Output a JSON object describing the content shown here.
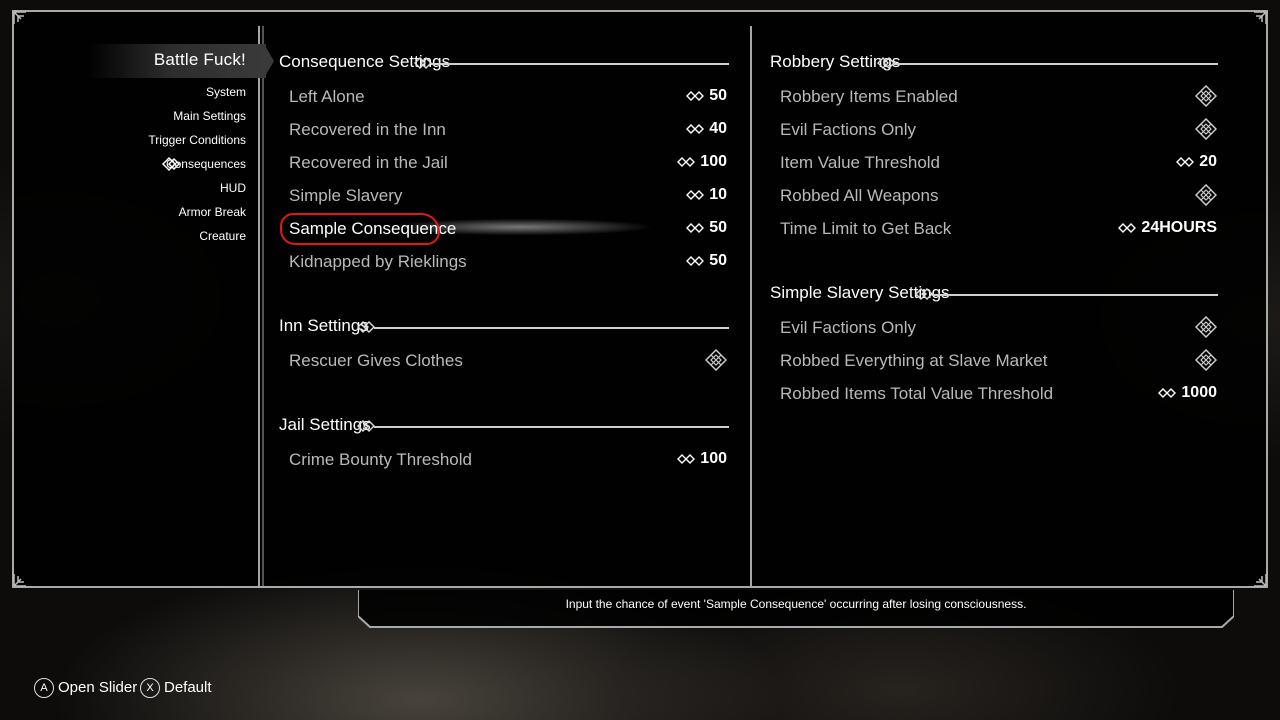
{
  "sidebar": {
    "title": "Battle Fuck!",
    "items": [
      {
        "label": "System"
      },
      {
        "label": "Main Settings"
      },
      {
        "label": "Trigger Conditions"
      },
      {
        "label": "Consequences"
      },
      {
        "label": "HUD"
      },
      {
        "label": "Armor Break"
      },
      {
        "label": "Creature"
      }
    ],
    "selected_index": 3
  },
  "left_column": {
    "consequence": {
      "title": "Consequence Settings",
      "rows": [
        {
          "label": "Left Alone",
          "value": "50"
        },
        {
          "label": "Recovered in the Inn",
          "value": "40"
        },
        {
          "label": "Recovered in the Jail",
          "value": "100"
        },
        {
          "label": "Simple Slavery",
          "value": "10"
        },
        {
          "label": "Sample Consequence",
          "value": "50"
        },
        {
          "label": "Kidnapped by Rieklings",
          "value": "50"
        }
      ]
    },
    "inn": {
      "title": "Inn Settings",
      "rows": [
        {
          "label": "Rescuer Gives Clothes",
          "type": "checkbox"
        }
      ]
    },
    "jail": {
      "title": "Jail Settings",
      "rows": [
        {
          "label": "Crime Bounty Threshold",
          "value": "100"
        }
      ]
    }
  },
  "right_column": {
    "robbery": {
      "title": "Robbery Settings",
      "rows": [
        {
          "label": "Robbery Items Enabled",
          "type": "checkbox"
        },
        {
          "label": "Evil Factions Only",
          "type": "checkbox"
        },
        {
          "label": "Item Value Threshold",
          "value": "20"
        },
        {
          "label": "Robbed All Weapons",
          "type": "checkbox"
        },
        {
          "label": "Time Limit to Get Back",
          "value": "24HOURS"
        }
      ]
    },
    "slavery": {
      "title": "Simple Slavery Settings",
      "rows": [
        {
          "label": "Evil Factions Only",
          "type": "checkbox"
        },
        {
          "label": "Robbed Everything at Slave Market",
          "type": "checkbox"
        },
        {
          "label": "Robbed Items Total Value Threshold",
          "value": "1000"
        }
      ]
    }
  },
  "info_text": "Input the chance of event 'Sample Consequence' occurring after losing consciousness.",
  "hints": [
    {
      "button": "A",
      "label": "Open Slider"
    },
    {
      "button": "X",
      "label": "Default"
    }
  ],
  "colors": {
    "highlight_ring": "#e01818",
    "frame": "#a9a9a9",
    "label_text": "#b9b9b9"
  }
}
